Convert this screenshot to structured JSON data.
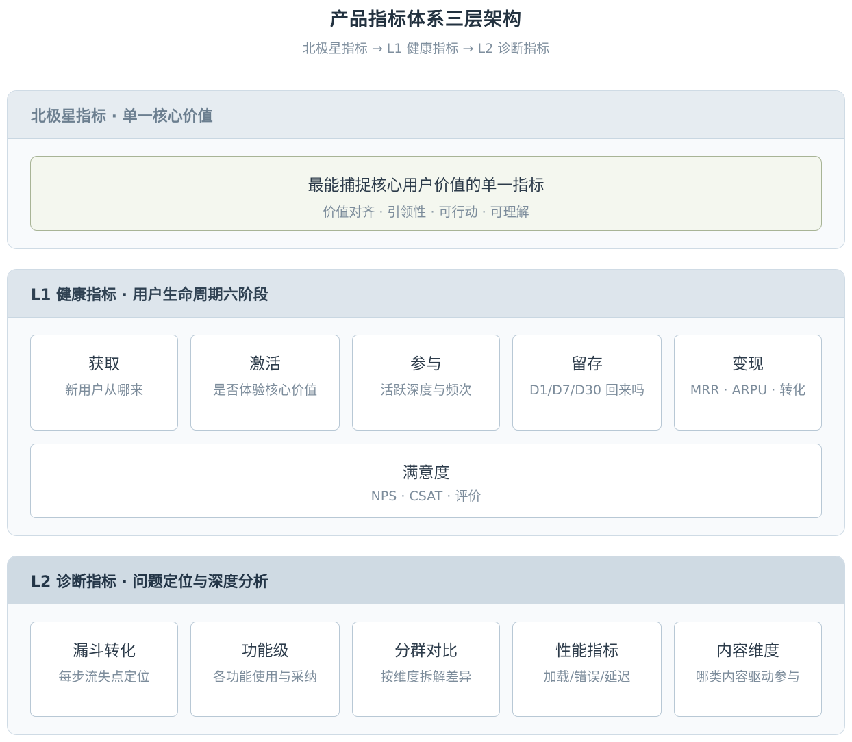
{
  "header": {
    "title": "产品指标体系三层架构",
    "subtitle": "北极星指标 → L1 健康指标 → L2 诊断指标"
  },
  "north_star": {
    "heading": "北极星指标 · 单一核心价值",
    "card": {
      "title": "最能捕捉核心用户价值的单一指标",
      "desc": "价值对齐 · 引领性 · 可行动 · 可理解"
    }
  },
  "l1": {
    "heading": "L1 健康指标 · 用户生命周期六阶段",
    "cards": [
      {
        "title": "获取",
        "desc": "新用户从哪来"
      },
      {
        "title": "激活",
        "desc": "是否体验核心价值"
      },
      {
        "title": "参与",
        "desc": "活跃深度与频次"
      },
      {
        "title": "留存",
        "desc": "D1/D7/D30 回来吗"
      },
      {
        "title": "变现",
        "desc": "MRR · ARPU · 转化"
      },
      {
        "title": "满意度",
        "desc": "NPS · CSAT · 评价"
      }
    ]
  },
  "l2": {
    "heading": "L2 诊断指标 · 问题定位与深度分析",
    "cards": [
      {
        "title": "漏斗转化",
        "desc": "每步流失点定位"
      },
      {
        "title": "功能级",
        "desc": "各功能使用与采纳"
      },
      {
        "title": "分群对比",
        "desc": "按维度拆解差异"
      },
      {
        "title": "性能指标",
        "desc": "加载/错误/延迟"
      },
      {
        "title": "内容维度",
        "desc": "哪类内容驱动参与"
      }
    ]
  }
}
